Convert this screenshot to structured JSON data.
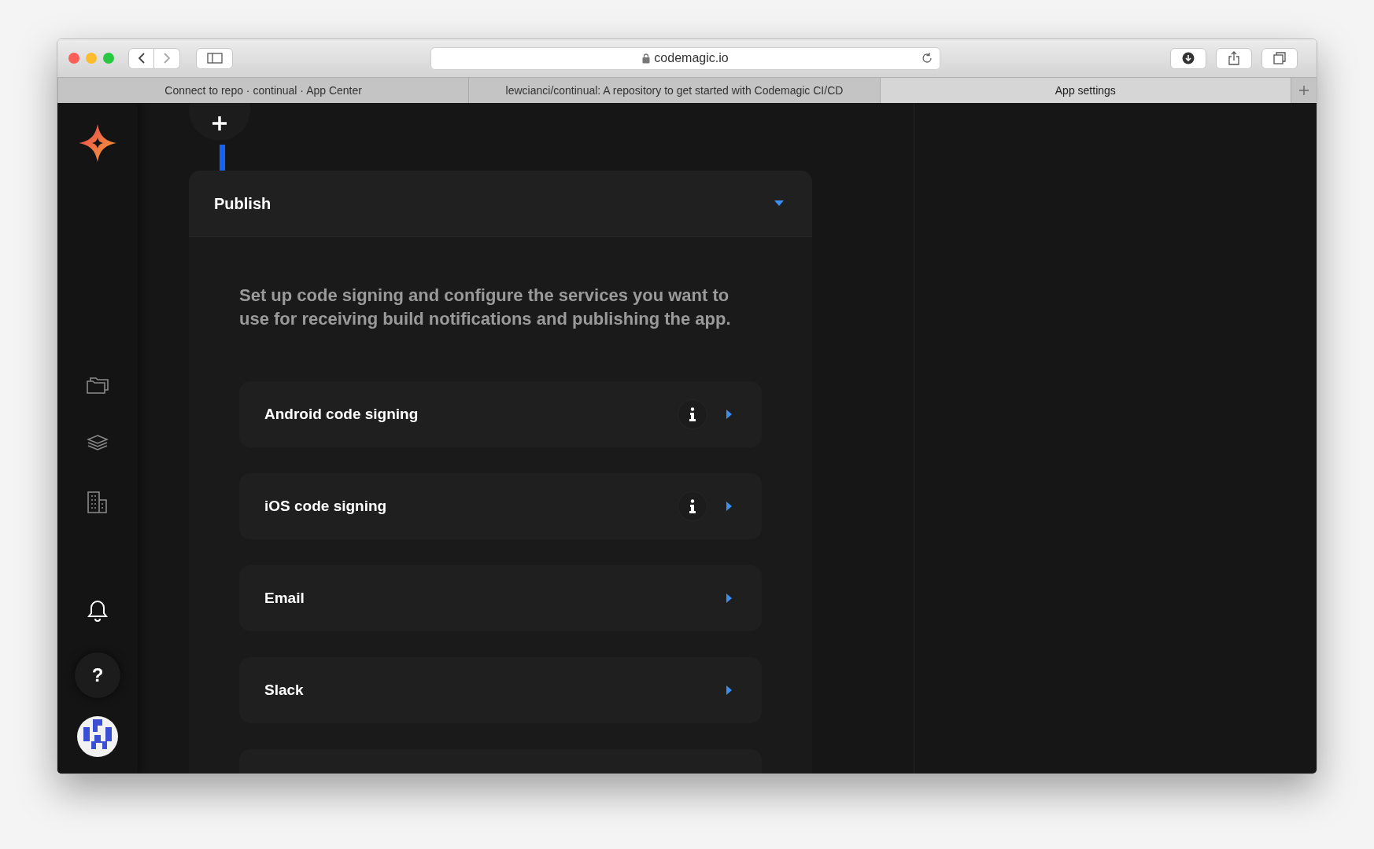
{
  "browser": {
    "address": "codemagic.io",
    "tabs": [
      {
        "label": "Connect to repo · continual · App Center",
        "selected": false
      },
      {
        "label": "lewcianci/continual: A repository to get started with Codemagic CI/CD",
        "selected": false
      },
      {
        "label": "App settings",
        "selected": true
      }
    ]
  },
  "section": {
    "title": "Publish",
    "expanded": true,
    "description": "Set up code signing and configure the services you want to use for receiving build notifications and publishing the app.",
    "items": [
      {
        "label": "Android code signing",
        "info": true
      },
      {
        "label": "iOS code signing",
        "info": true
      },
      {
        "label": "Email",
        "info": false
      },
      {
        "label": "Slack",
        "info": false
      }
    ]
  },
  "help_button": {
    "label": "?"
  }
}
